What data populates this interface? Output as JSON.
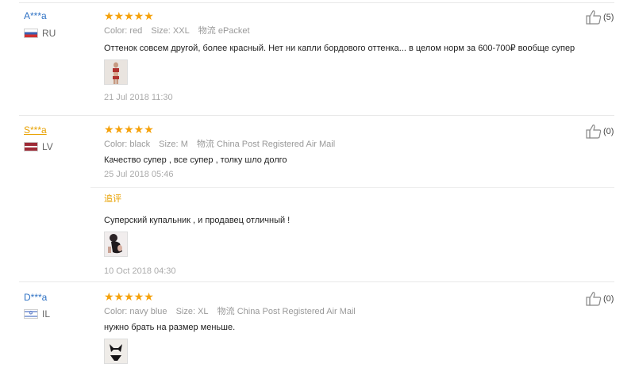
{
  "reviews": [
    {
      "user": "A***a",
      "country": "RU",
      "stars": "★★★★★",
      "color_label": "Color:",
      "color_value": "red",
      "size_label": "Size:",
      "size_value": "XXL",
      "ship_label": "物流",
      "ship_value": "ePacket",
      "text": "Оттенок совсем другой, более красный. Нет ни капли бордового оттенка... в целом норм за 600-700₽ вообще супер",
      "date": "21 Jul 2018 11:30",
      "likes": "(5)"
    },
    {
      "user": "S***a",
      "country": "LV",
      "stars": "★★★★★",
      "color_label": "Color:",
      "color_value": "black",
      "size_label": "Size:",
      "size_value": "M",
      "ship_label": "物流",
      "ship_value": "China Post Registered Air Mail",
      "text": "Качество супер , все супер , толку шло долго",
      "date": "25 Jul 2018 05:46",
      "followup_label": "追评",
      "followup_text": "Суперский купальник , и продавец отличный !",
      "followup_date": "10 Oct 2018 04:30",
      "likes": "(0)"
    },
    {
      "user": "D***a",
      "country": "IL",
      "stars": "★★★★★",
      "color_label": "Color:",
      "color_value": "navy blue",
      "size_label": "Size:",
      "size_value": "XL",
      "ship_label": "物流",
      "ship_value": "China Post Registered Air Mail",
      "text": "нужно брать на размер меньше.",
      "likes": "(0)"
    }
  ],
  "colors": {
    "star": "#f5a10a",
    "username": "#2f72c4",
    "username_highlight": "#e8a100",
    "muted": "#999999"
  },
  "icons": {
    "like": "thumbs-up-icon",
    "rating": "star-icon"
  }
}
